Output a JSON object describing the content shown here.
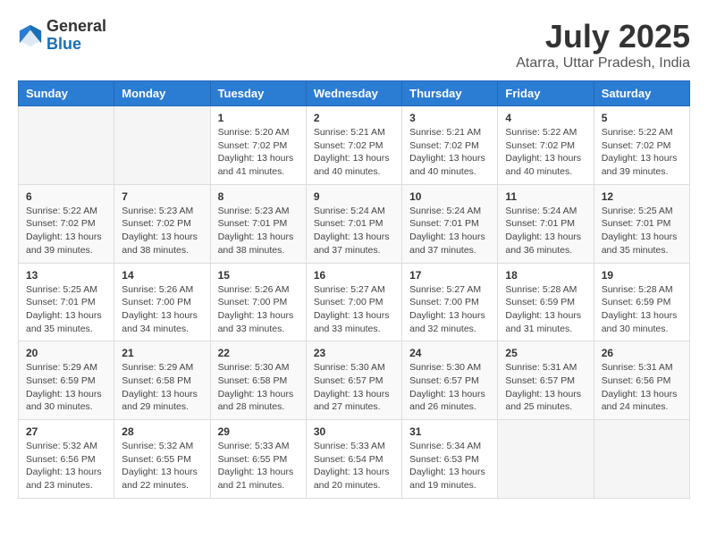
{
  "logo": {
    "general": "General",
    "blue": "Blue"
  },
  "title": {
    "month_year": "July 2025",
    "location": "Atarra, Uttar Pradesh, India"
  },
  "weekdays": [
    "Sunday",
    "Monday",
    "Tuesday",
    "Wednesday",
    "Thursday",
    "Friday",
    "Saturday"
  ],
  "weeks": [
    [
      {
        "day": "",
        "sunrise": "",
        "sunset": "",
        "daylight": ""
      },
      {
        "day": "",
        "sunrise": "",
        "sunset": "",
        "daylight": ""
      },
      {
        "day": "1",
        "sunrise": "Sunrise: 5:20 AM",
        "sunset": "Sunset: 7:02 PM",
        "daylight": "Daylight: 13 hours and 41 minutes."
      },
      {
        "day": "2",
        "sunrise": "Sunrise: 5:21 AM",
        "sunset": "Sunset: 7:02 PM",
        "daylight": "Daylight: 13 hours and 40 minutes."
      },
      {
        "day": "3",
        "sunrise": "Sunrise: 5:21 AM",
        "sunset": "Sunset: 7:02 PM",
        "daylight": "Daylight: 13 hours and 40 minutes."
      },
      {
        "day": "4",
        "sunrise": "Sunrise: 5:22 AM",
        "sunset": "Sunset: 7:02 PM",
        "daylight": "Daylight: 13 hours and 40 minutes."
      },
      {
        "day": "5",
        "sunrise": "Sunrise: 5:22 AM",
        "sunset": "Sunset: 7:02 PM",
        "daylight": "Daylight: 13 hours and 39 minutes."
      }
    ],
    [
      {
        "day": "6",
        "sunrise": "Sunrise: 5:22 AM",
        "sunset": "Sunset: 7:02 PM",
        "daylight": "Daylight: 13 hours and 39 minutes."
      },
      {
        "day": "7",
        "sunrise": "Sunrise: 5:23 AM",
        "sunset": "Sunset: 7:02 PM",
        "daylight": "Daylight: 13 hours and 38 minutes."
      },
      {
        "day": "8",
        "sunrise": "Sunrise: 5:23 AM",
        "sunset": "Sunset: 7:01 PM",
        "daylight": "Daylight: 13 hours and 38 minutes."
      },
      {
        "day": "9",
        "sunrise": "Sunrise: 5:24 AM",
        "sunset": "Sunset: 7:01 PM",
        "daylight": "Daylight: 13 hours and 37 minutes."
      },
      {
        "day": "10",
        "sunrise": "Sunrise: 5:24 AM",
        "sunset": "Sunset: 7:01 PM",
        "daylight": "Daylight: 13 hours and 37 minutes."
      },
      {
        "day": "11",
        "sunrise": "Sunrise: 5:24 AM",
        "sunset": "Sunset: 7:01 PM",
        "daylight": "Daylight: 13 hours and 36 minutes."
      },
      {
        "day": "12",
        "sunrise": "Sunrise: 5:25 AM",
        "sunset": "Sunset: 7:01 PM",
        "daylight": "Daylight: 13 hours and 35 minutes."
      }
    ],
    [
      {
        "day": "13",
        "sunrise": "Sunrise: 5:25 AM",
        "sunset": "Sunset: 7:01 PM",
        "daylight": "Daylight: 13 hours and 35 minutes."
      },
      {
        "day": "14",
        "sunrise": "Sunrise: 5:26 AM",
        "sunset": "Sunset: 7:00 PM",
        "daylight": "Daylight: 13 hours and 34 minutes."
      },
      {
        "day": "15",
        "sunrise": "Sunrise: 5:26 AM",
        "sunset": "Sunset: 7:00 PM",
        "daylight": "Daylight: 13 hours and 33 minutes."
      },
      {
        "day": "16",
        "sunrise": "Sunrise: 5:27 AM",
        "sunset": "Sunset: 7:00 PM",
        "daylight": "Daylight: 13 hours and 33 minutes."
      },
      {
        "day": "17",
        "sunrise": "Sunrise: 5:27 AM",
        "sunset": "Sunset: 7:00 PM",
        "daylight": "Daylight: 13 hours and 32 minutes."
      },
      {
        "day": "18",
        "sunrise": "Sunrise: 5:28 AM",
        "sunset": "Sunset: 6:59 PM",
        "daylight": "Daylight: 13 hours and 31 minutes."
      },
      {
        "day": "19",
        "sunrise": "Sunrise: 5:28 AM",
        "sunset": "Sunset: 6:59 PM",
        "daylight": "Daylight: 13 hours and 30 minutes."
      }
    ],
    [
      {
        "day": "20",
        "sunrise": "Sunrise: 5:29 AM",
        "sunset": "Sunset: 6:59 PM",
        "daylight": "Daylight: 13 hours and 30 minutes."
      },
      {
        "day": "21",
        "sunrise": "Sunrise: 5:29 AM",
        "sunset": "Sunset: 6:58 PM",
        "daylight": "Daylight: 13 hours and 29 minutes."
      },
      {
        "day": "22",
        "sunrise": "Sunrise: 5:30 AM",
        "sunset": "Sunset: 6:58 PM",
        "daylight": "Daylight: 13 hours and 28 minutes."
      },
      {
        "day": "23",
        "sunrise": "Sunrise: 5:30 AM",
        "sunset": "Sunset: 6:57 PM",
        "daylight": "Daylight: 13 hours and 27 minutes."
      },
      {
        "day": "24",
        "sunrise": "Sunrise: 5:30 AM",
        "sunset": "Sunset: 6:57 PM",
        "daylight": "Daylight: 13 hours and 26 minutes."
      },
      {
        "day": "25",
        "sunrise": "Sunrise: 5:31 AM",
        "sunset": "Sunset: 6:57 PM",
        "daylight": "Daylight: 13 hours and 25 minutes."
      },
      {
        "day": "26",
        "sunrise": "Sunrise: 5:31 AM",
        "sunset": "Sunset: 6:56 PM",
        "daylight": "Daylight: 13 hours and 24 minutes."
      }
    ],
    [
      {
        "day": "27",
        "sunrise": "Sunrise: 5:32 AM",
        "sunset": "Sunset: 6:56 PM",
        "daylight": "Daylight: 13 hours and 23 minutes."
      },
      {
        "day": "28",
        "sunrise": "Sunrise: 5:32 AM",
        "sunset": "Sunset: 6:55 PM",
        "daylight": "Daylight: 13 hours and 22 minutes."
      },
      {
        "day": "29",
        "sunrise": "Sunrise: 5:33 AM",
        "sunset": "Sunset: 6:55 PM",
        "daylight": "Daylight: 13 hours and 21 minutes."
      },
      {
        "day": "30",
        "sunrise": "Sunrise: 5:33 AM",
        "sunset": "Sunset: 6:54 PM",
        "daylight": "Daylight: 13 hours and 20 minutes."
      },
      {
        "day": "31",
        "sunrise": "Sunrise: 5:34 AM",
        "sunset": "Sunset: 6:53 PM",
        "daylight": "Daylight: 13 hours and 19 minutes."
      },
      {
        "day": "",
        "sunrise": "",
        "sunset": "",
        "daylight": ""
      },
      {
        "day": "",
        "sunrise": "",
        "sunset": "",
        "daylight": ""
      }
    ]
  ]
}
